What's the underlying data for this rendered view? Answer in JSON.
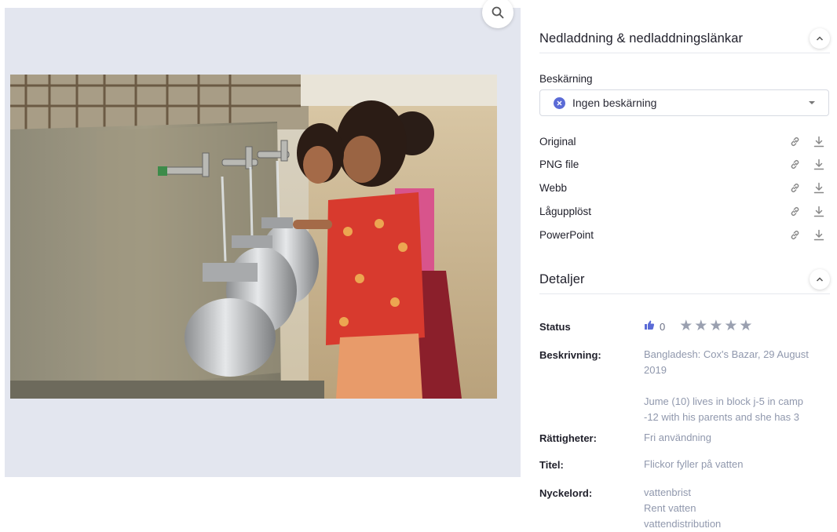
{
  "viewer": {
    "zoom_icon": "search-icon"
  },
  "downloads_section": {
    "title": "Nedladdning & nedladdningslänkar",
    "crop_label": "Beskärning",
    "crop_value": "Ingen beskärning",
    "items": [
      {
        "label": "Original"
      },
      {
        "label": "PNG file"
      },
      {
        "label": "Webb"
      },
      {
        "label": "Lågupplöst"
      },
      {
        "label": "PowerPoint"
      }
    ],
    "item_icons": [
      "link-icon",
      "download-icon"
    ]
  },
  "details_section": {
    "title": "Detaljer",
    "status_label": "Status",
    "likes": "0",
    "rating": {
      "value": 0,
      "max": 5
    },
    "description_label": "Beskrivning:",
    "description_line1": "Bangladesh: Cox's Bazar, 29 August",
    "description_line2": "2019",
    "description_line3": "Jume (10) lives in block j-5 in camp",
    "description_line4": "-12 with his parents and she has 3",
    "rights_label": "Rättigheter:",
    "rights_value": "Fri användning",
    "title_label": "Titel:",
    "title_value": "Flickor fyller på vatten",
    "keywords_label": "Nyckelord:",
    "keywords": [
      "vattenbrist",
      "Rent vatten",
      "vattendistribution"
    ]
  },
  "colors": {
    "accent": "#5b6bd6",
    "muted_text": "#9098ad",
    "viewer_bg": "#e3e6ef"
  }
}
